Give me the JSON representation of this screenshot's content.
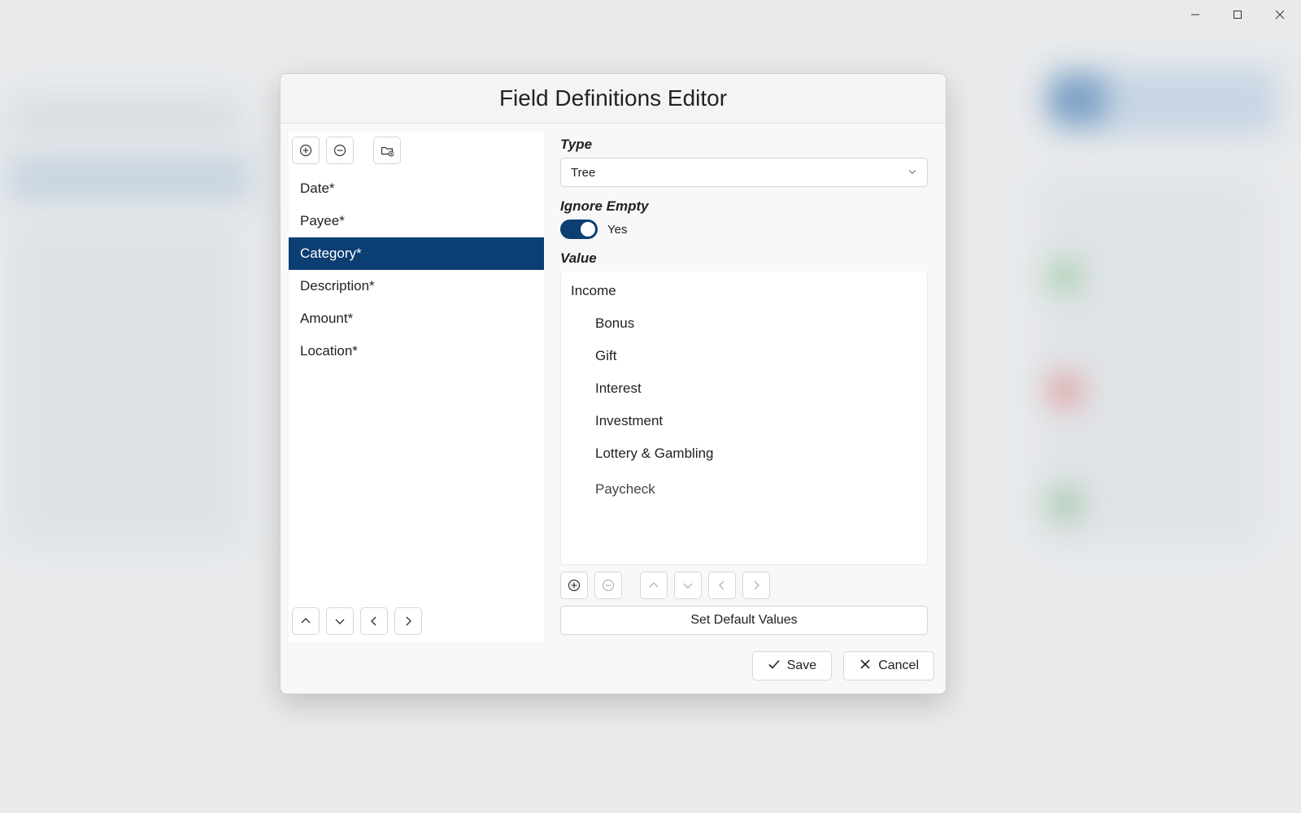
{
  "dialog": {
    "title": "Field Definitions Editor",
    "fields": [
      {
        "label": "Date*"
      },
      {
        "label": "Payee*"
      },
      {
        "label": "Category*"
      },
      {
        "label": "Description*"
      },
      {
        "label": "Amount*"
      },
      {
        "label": "Location*"
      }
    ],
    "selected_index": 2,
    "right": {
      "type_label": "Type",
      "type_value": "Tree",
      "ignore_label": "Ignore Empty",
      "ignore_value": "Yes",
      "value_label": "Value",
      "tree": {
        "root": "Income",
        "children": [
          "Bonus",
          "Gift",
          "Interest",
          "Investment",
          "Lottery & Gambling",
          "Paycheck"
        ]
      },
      "default_button": "Set Default Values"
    },
    "footer": {
      "save": "Save",
      "cancel": "Cancel"
    }
  }
}
